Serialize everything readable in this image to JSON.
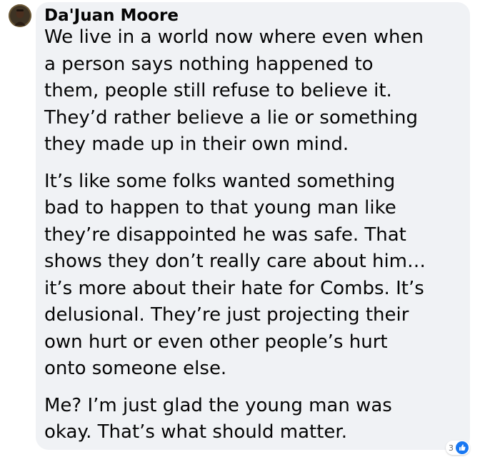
{
  "comment": {
    "author": "Da'Juan Moore",
    "avatar_icon": "user-avatar",
    "paragraphs": [
      "We live in a world now where even when\na person says nothing happened to\nthem, people still refuse to believe it.\nThey’d rather believe a lie or something\nthey made up in their own mind.",
      "It’s like some folks wanted something\nbad to happen to that young man like\nthey’re disappointed he was safe. That\nshows they don’t really care about him…\nit’s more about their hate for Combs. It’s\ndelusional. They’re just projecting their\nown hurt or even other people’s hurt\nonto someone else.",
      "Me? I’m just glad the young man was\nokay. That’s what should matter."
    ],
    "reactions": {
      "count": "3",
      "icon": "like-icon",
      "color": "#1877f2"
    }
  },
  "colors": {
    "bubble_background": "#f0f2f5",
    "text": "#050505",
    "secondary_text": "#65676b"
  }
}
